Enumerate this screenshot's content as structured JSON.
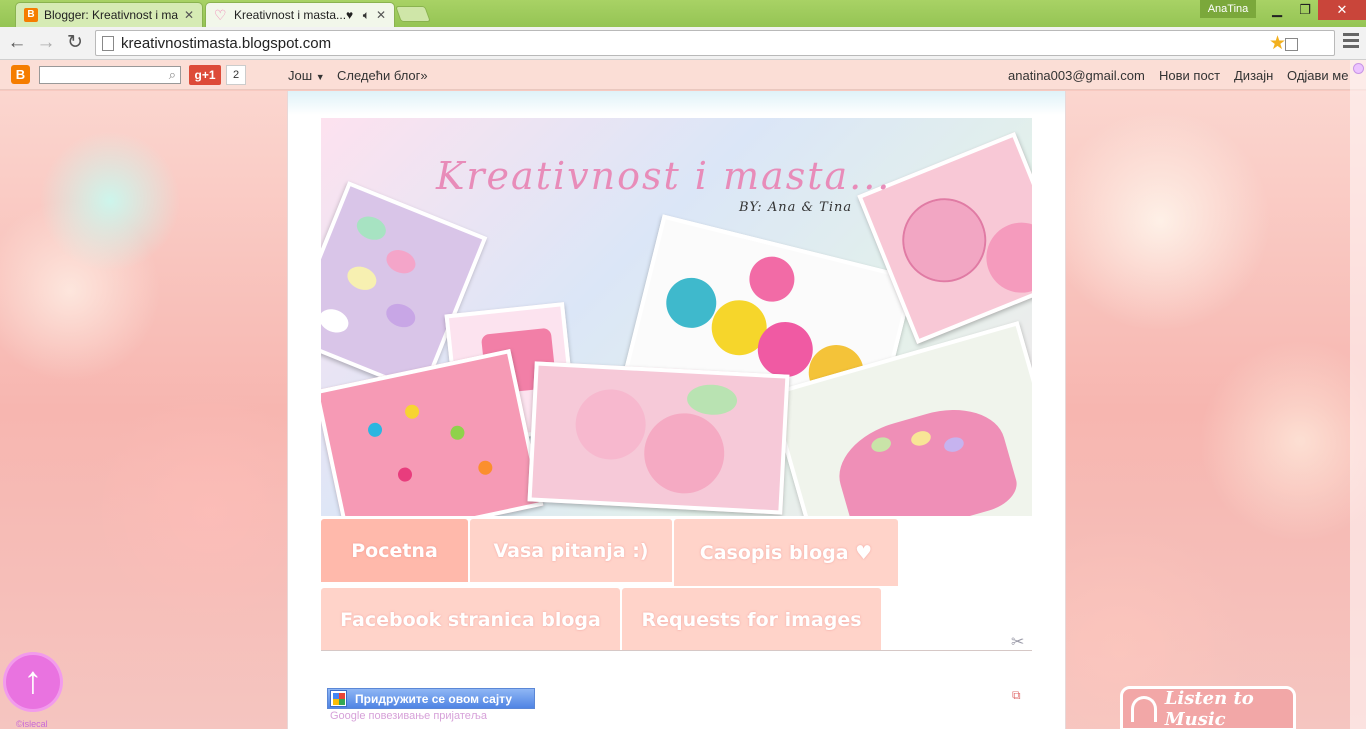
{
  "browser": {
    "tabs": [
      {
        "title": "Blogger: Kreativnost i mas",
        "favicon": "blogger-icon",
        "active": false
      },
      {
        "title": "Kreativnost i masta...♥",
        "favicon": "heart-icon",
        "active": true
      }
    ],
    "profile_name": "AnaTina",
    "url": "kreativnostimasta.blogspot.com"
  },
  "blogger_nav": {
    "plus_label": "g+1",
    "plus_count": "2",
    "more_label": "Још",
    "follow_label": "Следећи блог»",
    "email": "anatina003@gmail.com",
    "new_post": "Нови пост",
    "design": "Дизајн",
    "sign_out": "Одјави ме"
  },
  "blog": {
    "title": "Kreativnost i masta...",
    "subtitle": "BY: Ana & Tina",
    "tabs": [
      {
        "label": "Pocetna",
        "selected": true
      },
      {
        "label": "Vasa pitanja :)",
        "selected": false
      },
      {
        "label": "Casopis bloga ♥",
        "selected": false
      },
      {
        "label": "Facebook stranica bloga",
        "selected": false
      },
      {
        "label": "Requests for images",
        "selected": false
      }
    ],
    "join_button": "Придружите се овом сајту",
    "google_note": "Google повезивање пријатеља",
    "music_widget": "Listen to Music",
    "credit": "©islecal"
  },
  "colors": {
    "chrome_titlebar": "#a8d265",
    "tab_bg": "#ffd3c9",
    "tab_selected_bg": "#ffb9ab",
    "title_pink": "#e88cb9",
    "to_top_purple": "#e973e0"
  }
}
